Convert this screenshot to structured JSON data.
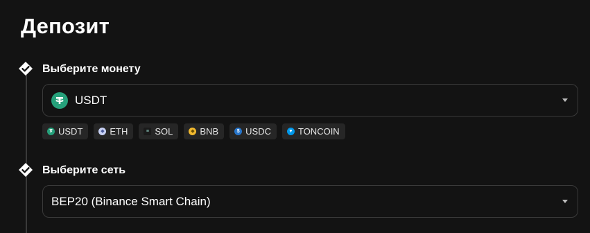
{
  "page": {
    "title": "Депозит"
  },
  "steps": {
    "coin": {
      "label": "Выберите монету",
      "selected": "USDT",
      "selected_icon": "tether-icon"
    },
    "network": {
      "label": "Выберите сеть",
      "selected": "BEP20 (Binance Smart Chain)"
    }
  },
  "quick_coins": [
    {
      "label": "USDT",
      "icon": "tether-icon",
      "color": "#26a17b"
    },
    {
      "label": "ETH",
      "icon": "ethereum-icon",
      "color": "#c9d2f5"
    },
    {
      "label": "SOL",
      "icon": "solana-icon",
      "color": "#9945ff"
    },
    {
      "label": "BNB",
      "icon": "bnb-icon",
      "color": "#f3ba2f"
    },
    {
      "label": "USDC",
      "icon": "usdc-icon",
      "color": "#2775ca"
    },
    {
      "label": "TONCOIN",
      "icon": "toncoin-icon",
      "color": "#0098ea"
    }
  ],
  "colors": {
    "background": "#131313",
    "border": "#3a3a3a",
    "chip_background": "#262626",
    "text": "#ffffff"
  }
}
